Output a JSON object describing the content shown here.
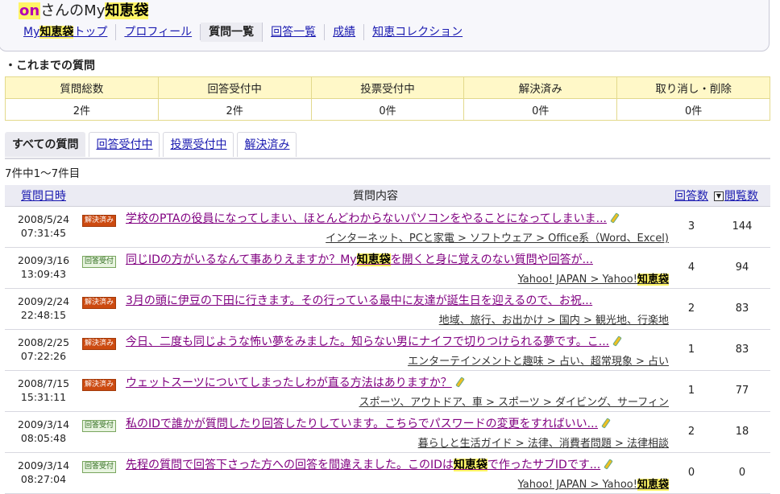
{
  "header": {
    "user": "on",
    "title_mid": "さんのMy",
    "title_hl": "知恵袋",
    "nav": [
      {
        "pre": "My",
        "hl": "知恵袋",
        "post": "トップ"
      },
      {
        "label": "プロフィール"
      },
      {
        "label": "質問一覧",
        "active": true
      },
      {
        "label": "回答一覧"
      },
      {
        "label": "成績"
      },
      {
        "label": "知恵コレクション"
      }
    ]
  },
  "summary": {
    "title": "・これまでの質問",
    "headers": [
      "質問総数",
      "回答受付中",
      "投票受付中",
      "解決済み",
      "取り消し・削除"
    ],
    "values": [
      "2件",
      "2件",
      "0件",
      "0件",
      "0件"
    ]
  },
  "tabs": [
    "すべての質問",
    "回答受付中",
    "投票受付中",
    "解決済み"
  ],
  "count_text": "7件中1～7件目",
  "list_head": {
    "date": "質問日時",
    "content": "質問内容",
    "answers": "回答数",
    "views": "閲覧数",
    "sort_icon": "▼"
  },
  "rows": [
    {
      "date": "2008/5/24",
      "time": "07:31:45",
      "status": "解決済み",
      "kind": "solved",
      "title": "学校のPTAの役員になってしまい、ほとんどわからないパソコンをやることになってしまいま...",
      "category": "インターネット、PCと家電 > ソフトウェア > Office系（Word、Excel)",
      "answers": "3",
      "views": "144"
    },
    {
      "date": "2009/3/16",
      "time": "13:09:43",
      "status": "回答受付",
      "kind": "open",
      "title_pre": "同じIDの方がいるなんて事ありえますか？My",
      "title_hl": "知恵袋",
      "title_post": "を開くと身に覚えのない質問や回答が...",
      "category_pre": "Yahoo! JAPAN > Yahoo!",
      "category_hl": "知恵袋",
      "answers": "4",
      "views": "94"
    },
    {
      "date": "2009/2/24",
      "time": "22:48:15",
      "status": "解決済み",
      "kind": "solved",
      "title": "3月の頭に伊豆の下田に行きます。その行っている最中に友達が誕生日を迎えるので、お祝...",
      "category": "地域、旅行、お出かけ > 国内 > 観光地、行楽地",
      "answers": "2",
      "views": "83"
    },
    {
      "date": "2008/2/25",
      "time": "07:22:26",
      "status": "解決済み",
      "kind": "solved",
      "title": "今日、二度も同じような怖い夢をみました。知らない男にナイフで切りつけられる夢です。こ...",
      "category": "エンターテインメントと趣味 > 占い、超常現象 > 占い",
      "answers": "1",
      "views": "83"
    },
    {
      "date": "2008/7/15",
      "time": "15:31:11",
      "status": "解決済み",
      "kind": "solved",
      "title": "ウェットスーツについてしまったしわが直る方法はありますか？",
      "category": "スポーツ、アウトドア、車 > スポーツ > ダイビング、サーフィン",
      "answers": "1",
      "views": "77"
    },
    {
      "date": "2009/3/14",
      "time": "08:05:48",
      "status": "回答受付",
      "kind": "open",
      "title": "私のIDで誰かが質問したり回答したりしています。こちらでパスワードの変更をすればいい...",
      "category": "暮らしと生活ガイド > 法律、消費者問題 > 法律相談",
      "answers": "2",
      "views": "18"
    },
    {
      "date": "2009/3/14",
      "time": "08:27:04",
      "status": "回答受付",
      "kind": "open",
      "title_pre": "先程の質問で回答下さった方への回答を間違えました。このIDは",
      "title_hl": "知恵袋",
      "title_post": "で作ったサブIDです...",
      "category_pre": "Yahoo! JAPAN > Yahoo!",
      "category_hl": "知恵袋",
      "answers": "0",
      "views": "0"
    }
  ],
  "colors": {
    "solved_badge": "#cc4a10",
    "open_badge": "#e8f4e0",
    "highlight": "#fff566",
    "summary_header": "#fff8c8"
  }
}
